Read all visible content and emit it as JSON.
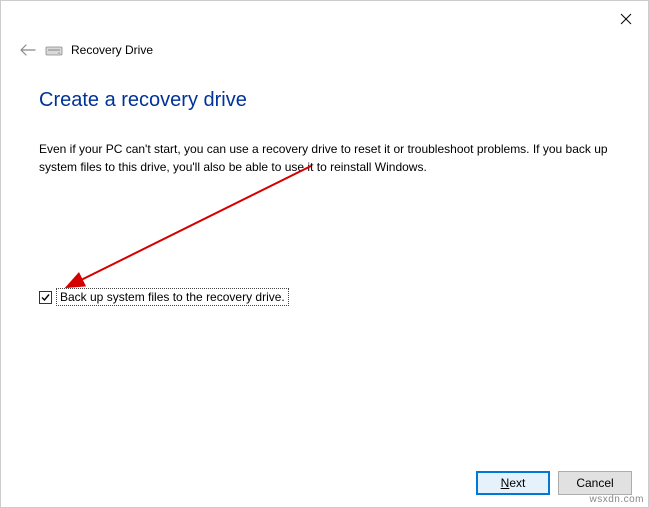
{
  "window": {
    "title": "Recovery Drive"
  },
  "page": {
    "title": "Create a recovery drive",
    "description": "Even if your PC can't start, you can use a recovery drive to reset it or troubleshoot problems. If you back up system files to this drive, you'll also be able to use it to reinstall Windows."
  },
  "checkbox": {
    "label": "Back up system files to the recovery drive.",
    "checked": true
  },
  "buttons": {
    "next": "Next",
    "cancel": "Cancel"
  },
  "watermark": "wsxdn.com"
}
